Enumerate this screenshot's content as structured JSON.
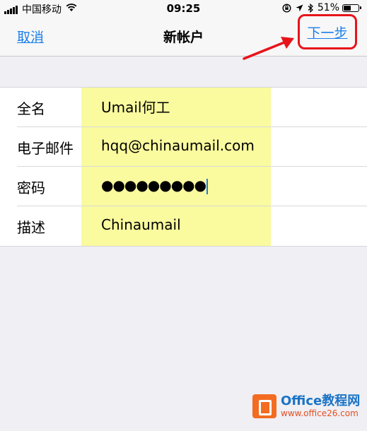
{
  "status_bar": {
    "carrier": "中国移动",
    "time": "09:25",
    "battery_percent": "51%",
    "battery_level": 0.51,
    "icons": [
      "signal-icon",
      "wifi-icon",
      "orientation-lock-icon",
      "location-icon",
      "bluetooth-icon",
      "battery-icon"
    ]
  },
  "nav": {
    "cancel_label": "取消",
    "title": "新帐户",
    "next_label": "下一步"
  },
  "form": {
    "rows": [
      {
        "label": "全名",
        "value": "Umail何工"
      },
      {
        "label": "电子邮件",
        "value": "hqq@chinaumail.com"
      },
      {
        "label": "密码",
        "value": "●●●●●●●●●"
      },
      {
        "label": "描述",
        "value": "Chinaumail"
      }
    ]
  },
  "colors": {
    "accent": "#1a7fe8",
    "annotation_red": "#e8131a",
    "highlight_yellow": "#fafa9e",
    "background": "#efeff4"
  },
  "watermark": {
    "line1": "Office教程网",
    "line2": "www.office26.com"
  }
}
